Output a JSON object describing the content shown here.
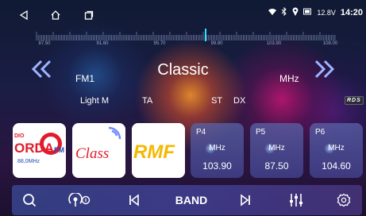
{
  "status": {
    "battery": "12.8V",
    "time": "14:20"
  },
  "scale": {
    "labels": [
      "87.50",
      "91.60",
      "95.70",
      "99.80",
      "103.90",
      "108.00"
    ]
  },
  "station": {
    "name": "Classic",
    "band": "FM1",
    "unit": "MHz",
    "ps": "Light M",
    "ta": "TA",
    "st": "ST",
    "dx": "DX",
    "rds": "RDS"
  },
  "presets": [
    {
      "type": "logo",
      "brand": "ORDA FM",
      "sub": "88,0MHz",
      "small": "DIO"
    },
    {
      "type": "logo",
      "brand": "Class",
      "active": true
    },
    {
      "type": "logo",
      "brand": "RMF"
    },
    {
      "type": "freq",
      "name": "P4",
      "unit": "MHz",
      "freq": "103.90"
    },
    {
      "type": "freq",
      "name": "P5",
      "unit": "MHz",
      "freq": "87.50"
    },
    {
      "type": "freq",
      "name": "P6",
      "unit": "MHz",
      "freq": "104.60"
    }
  ],
  "toolbar": {
    "band_label": "BAND"
  },
  "icons": [
    "back-icon",
    "home-icon",
    "recents-icon",
    "wifi-icon",
    "bluetooth-icon",
    "location-icon",
    "battery-icon",
    "prev-station-icon",
    "next-station-icon",
    "search-icon",
    "podcast-icon",
    "skip-previous-icon",
    "skip-next-icon",
    "equalizer-icon",
    "settings-icon"
  ]
}
